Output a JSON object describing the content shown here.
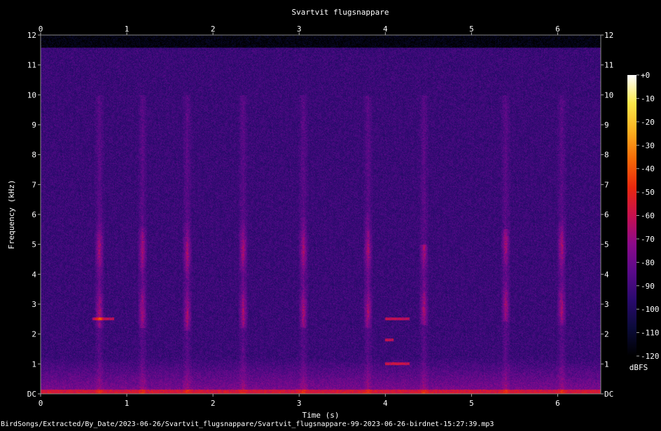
{
  "chart_data": {
    "type": "heatmap",
    "title": "Svartvit flugsnappare",
    "xlabel": "Time (s)",
    "ylabel": "Frequency (kHz)",
    "xlim": [
      0,
      6.5
    ],
    "ylim": [
      0,
      12
    ],
    "x_ticks": [
      "0",
      "1",
      "2",
      "3",
      "4",
      "5",
      "6"
    ],
    "x_tick_values": [
      0,
      1,
      2,
      3,
      4,
      5,
      6
    ],
    "y_ticks": [
      "DC",
      "1",
      "2",
      "3",
      "4",
      "5",
      "6",
      "7",
      "8",
      "9",
      "10",
      "11",
      "12"
    ],
    "y_tick_values": [
      0,
      1,
      2,
      3,
      4,
      5,
      6,
      7,
      8,
      9,
      10,
      11,
      12
    ],
    "colorbar": {
      "label": "dBFS",
      "ticks": [
        "+0",
        "-10",
        "-20",
        "-30",
        "-40",
        "-50",
        "-60",
        "-70",
        "-80",
        "-90",
        "-100",
        "-110",
        "-120"
      ],
      "range": [
        -120,
        0
      ],
      "colors": [
        "#000000",
        "#0b0b3a",
        "#2a0a6e",
        "#5a0a8a",
        "#8c0a8a",
        "#c8104e",
        "#e8280e",
        "#f76a08",
        "#fbb020",
        "#fbe84a",
        "#ffffff"
      ]
    },
    "background_dbfs": -92,
    "noise_ceiling_khz": 11.6,
    "calls": [
      {
        "t": 0.68,
        "f_low": 2.2,
        "f_high": 5.8
      },
      {
        "t": 1.18,
        "f_low": 2.2,
        "f_high": 5.6
      },
      {
        "t": 1.7,
        "f_low": 2.1,
        "f_high": 5.8
      },
      {
        "t": 2.35,
        "f_low": 2.2,
        "f_high": 5.8
      },
      {
        "t": 3.05,
        "f_low": 2.2,
        "f_high": 5.9
      },
      {
        "t": 3.8,
        "f_low": 2.2,
        "f_high": 6.0
      },
      {
        "t": 4.45,
        "f_low": 2.3,
        "f_high": 5.0
      },
      {
        "t": 5.4,
        "f_low": 2.4,
        "f_high": 5.5
      },
      {
        "t": 6.05,
        "f_low": 2.3,
        "f_high": 5.8
      }
    ],
    "tonal_bands": [
      {
        "t0": 0.6,
        "t1": 0.85,
        "f": 2.5
      },
      {
        "t0": 4.0,
        "t1": 4.28,
        "f": 2.5
      },
      {
        "t0": 4.0,
        "t1": 4.28,
        "f": 1.0
      },
      {
        "t0": 4.0,
        "t1": 4.1,
        "f": 1.8
      }
    ]
  },
  "footer": {
    "path": "BirdSongs/Extracted/By_Date/2023-06-26/Svartvit_flugsnappare/Svartvit_flugsnappare-99-2023-06-26-birdnet-15:27:39.mp3"
  }
}
